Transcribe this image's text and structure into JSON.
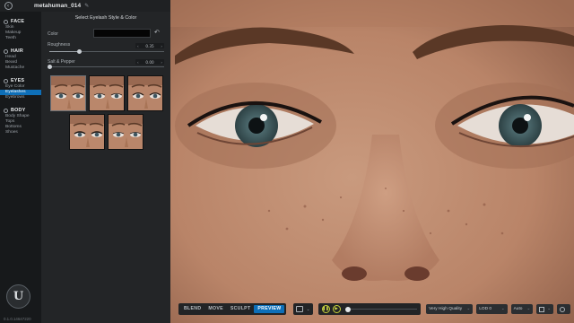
{
  "header": {
    "title": "metahuman_014"
  },
  "sidebar": {
    "groups": [
      {
        "label": "FACE",
        "items": [
          "Skin",
          "Makeup",
          "Teeth"
        ]
      },
      {
        "label": "HAIR",
        "items": [
          "Head",
          "Beard",
          "Mustache"
        ]
      },
      {
        "label": "EYES",
        "items": [
          "Eye Color",
          "Eyelashes",
          "Eyebrows"
        ]
      },
      {
        "label": "BODY",
        "items": [
          "Body Shape",
          "Tops",
          "Bottoms",
          "Shoes"
        ]
      }
    ],
    "active_item": "Eyelashes",
    "version": "0.1.0.14647220"
  },
  "panel": {
    "title": "Select Eyelash Style & Color",
    "color_label": "Color",
    "color_value": "#050505",
    "roughness_label": "Roughness",
    "roughness_value": "0.35",
    "roughness_fraction": 0.26,
    "salt_label": "Salt & Pepper",
    "salt_value": "0.00",
    "salt_fraction": 0.0,
    "thumbnails": [
      "eyelash-style-1",
      "eyelash-style-2",
      "eyelash-style-3",
      "eyelash-style-4",
      "eyelash-style-5"
    ]
  },
  "toolbar": {
    "modes": [
      "BLEND",
      "MOVE",
      "SCULPT",
      "PREVIEW"
    ],
    "active_mode": "PREVIEW",
    "quality": "Very High Quality",
    "lod": "LOD 0",
    "auto": "Auto"
  },
  "colors": {
    "accent": "#0e6fb8",
    "play_accent": "#c7d23a"
  }
}
